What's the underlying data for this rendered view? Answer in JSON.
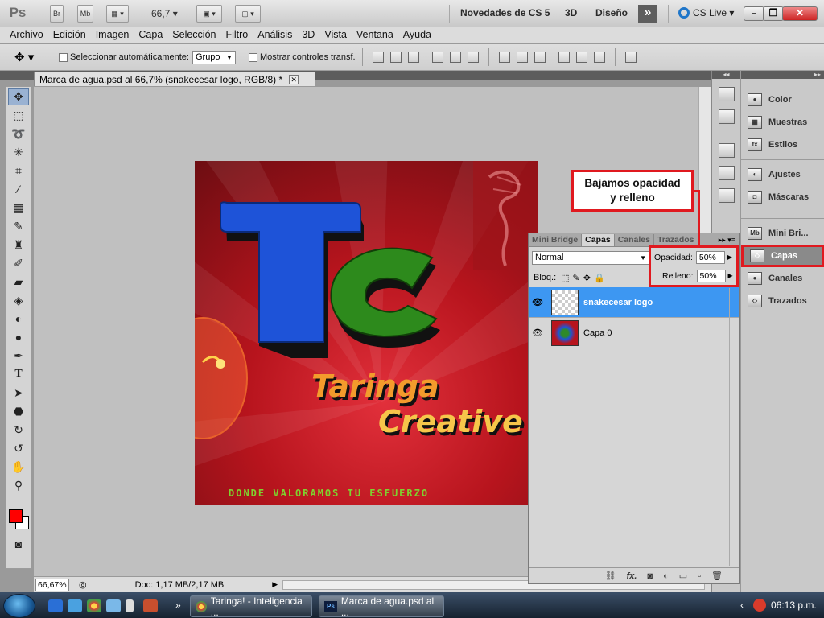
{
  "appbar": {
    "logo": "Ps",
    "bridge_btn": "Br",
    "minibridge_btn": "Mb",
    "zoom_value": "66,7",
    "workspaces": [
      "Novedades de CS 5",
      "3D",
      "Diseño"
    ],
    "more_glyph": "»",
    "cs_live": "CS Live",
    "window_buttons": {
      "minimize": "–",
      "restore": "❐",
      "close": "✕"
    }
  },
  "menubar": [
    "Archivo",
    "Edición",
    "Imagen",
    "Capa",
    "Selección",
    "Filtro",
    "Análisis",
    "3D",
    "Vista",
    "Ventana",
    "Ayuda"
  ],
  "options_bar": {
    "auto_select_label": "Seleccionar automáticamente:",
    "auto_select_value": "Grupo",
    "show_transform_label": "Mostrar controles transf."
  },
  "document_tab": {
    "title": "Marca de agua.psd al 66,7% (snakecesar logo, RGB/8) *",
    "close": "✕"
  },
  "artwork": {
    "big_letters_1": "T",
    "big_letters_2": "C",
    "line1": "Taringa",
    "line2": "Creative",
    "slogan": "DONDE VALORAMOS TU ESFUERZO",
    "colors": {
      "blue": "#1e53d8",
      "green": "#2d8a1c",
      "red_bg": "#b7141d",
      "orange": "#f29a2e"
    }
  },
  "status": {
    "zoom": "66,67%",
    "doc": "Doc: 1,17 MB/2,17 MB"
  },
  "dock": {
    "items_group1": [
      {
        "label": "Color",
        "icon": "color-icon"
      },
      {
        "label": "Muestras",
        "icon": "swatches-icon"
      },
      {
        "label": "Estilos",
        "icon": "styles-icon"
      }
    ],
    "items_group2": [
      {
        "label": "Ajustes",
        "icon": "adjustments-icon"
      },
      {
        "label": "Máscaras",
        "icon": "masks-icon"
      }
    ],
    "items_group3": [
      {
        "label": "Mini Bri...",
        "icon": "minibridge-icon"
      },
      {
        "label": "Capas",
        "icon": "layers-icon"
      },
      {
        "label": "Canales",
        "icon": "channels-icon"
      },
      {
        "label": "Trazados",
        "icon": "paths-icon"
      }
    ]
  },
  "layers_panel": {
    "tabs": [
      "Mini Bridge",
      "Capas",
      "Canales",
      "Trazados"
    ],
    "blend_mode": "Normal",
    "opacity_label": "Opacidad:",
    "opacity_value": "50%",
    "lock_label": "Bloq.:",
    "fill_label": "Relleno:",
    "fill_value": "50%",
    "layers": [
      {
        "name": "snakecesar logo",
        "selected": true
      },
      {
        "name": "Capa 0",
        "selected": false
      }
    ],
    "footer_icons": [
      "link-icon",
      "fx-icon",
      "mask-icon",
      "adjustment-icon",
      "group-icon",
      "new-layer-icon",
      "trash-icon"
    ]
  },
  "annotation": {
    "text_line1": "Bajamos opacidad",
    "text_line2": "y relleno",
    "color": "#e0191f"
  },
  "taskbar": {
    "task1": "Taringa! - Inteligencia ...",
    "task2": "Marca de agua.psd al ...",
    "clock": "06:13 p.m.",
    "chevron": "»"
  }
}
